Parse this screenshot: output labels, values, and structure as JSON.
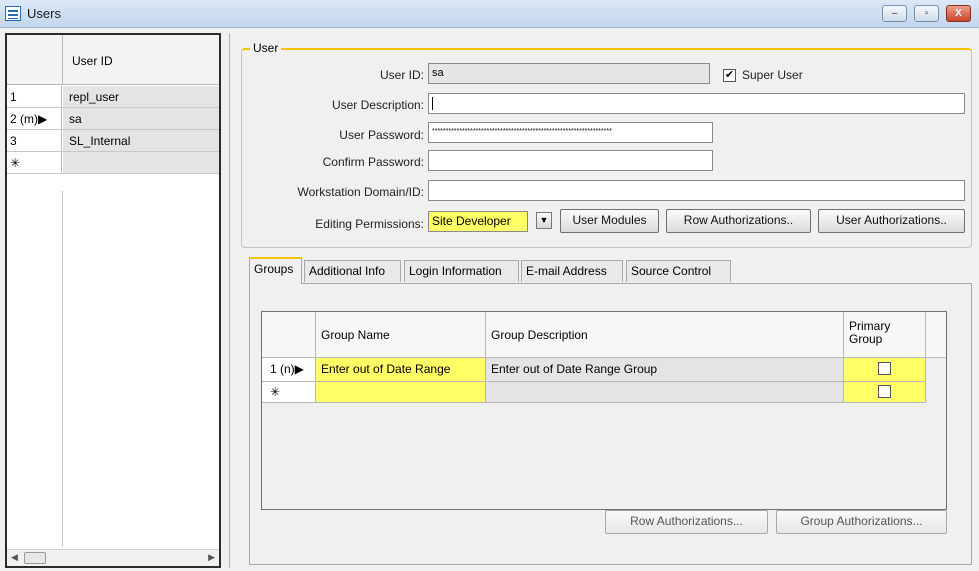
{
  "window": {
    "title": "Users",
    "minimize": "–",
    "restore": "▫",
    "close": "X"
  },
  "user_list": {
    "column_header": "User ID",
    "rows": [
      {
        "selector": "1",
        "user_id": "repl_user"
      },
      {
        "selector": "2 (m)▶",
        "user_id": "sa"
      },
      {
        "selector": "3",
        "user_id": "SL_Internal"
      },
      {
        "selector": "✳",
        "user_id": ""
      }
    ]
  },
  "user_group": {
    "legend": "User",
    "user_id_label": "User ID:",
    "user_id_value": "sa",
    "super_user_label": "Super User",
    "super_user_checked": "✔",
    "description_label": "User Description:",
    "description_value": "",
    "password_label": "User Password:",
    "password_value": "******************************************************************",
    "confirm_label": "Confirm Password:",
    "confirm_value": "",
    "workstation_label": "Workstation Domain/ID:",
    "workstation_value": "",
    "editing_label": "Editing Permissions:",
    "editing_value": "Site Developer",
    "user_modules_button": "User Modules",
    "row_auth_button": "Row Authorizations..",
    "user_auth_button": "User Authorizations.."
  },
  "tabs": [
    "Groups",
    "Additional Info",
    "Login Information",
    "E-mail Address",
    "Source Control"
  ],
  "groups_grid": {
    "headers": {
      "group_name": "Group Name",
      "group_description": "Group Description",
      "primary_group": "Primary Group"
    },
    "rows": [
      {
        "selector": "1 (n)▶",
        "group_name": "Enter out of Date Range",
        "group_description": "Enter out of Date Range Group",
        "primary": ""
      },
      {
        "selector": "✳",
        "group_name": "",
        "group_description": "",
        "primary": ""
      }
    ]
  },
  "groups_buttons": {
    "row_auth": "Row Authorizations...",
    "group_auth": "Group Authorizations..."
  },
  "icons": {
    "app": "table-window-icon",
    "checkbox": "checkbox-icon",
    "dropdown": "chevron-down-icon"
  }
}
